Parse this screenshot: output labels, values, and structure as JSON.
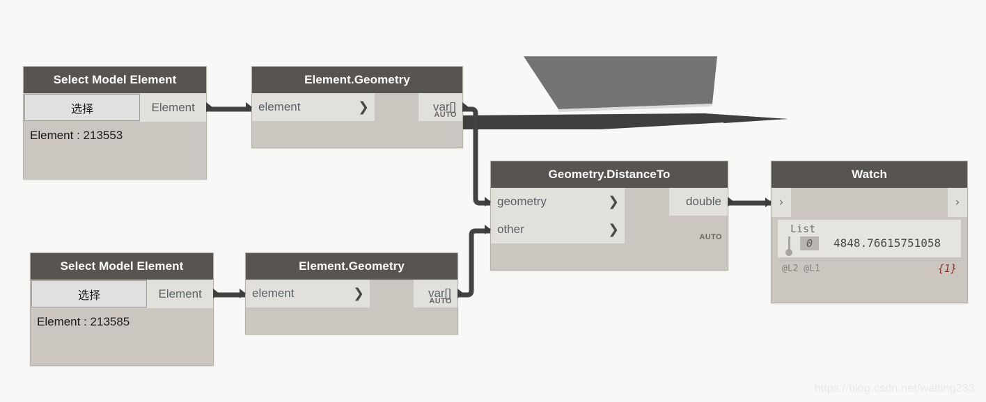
{
  "canvas": {
    "background": "#f8f8f7",
    "watermark": "https://blog.csdn.net/waiting233"
  },
  "theme": {
    "header_bg": "#585551",
    "header_text": "#ffffff",
    "node_body": "#cbc7c0",
    "port_bg": "#e2e0da",
    "port_text": "#5b6168",
    "wire": "#454341",
    "count_red": "#8d3030"
  },
  "nodes": [
    {
      "id": "select-model-element-1",
      "title": "Select Model Element",
      "button_label": "选择",
      "out_port": "Element",
      "value_label": "Element : 213553"
    },
    {
      "id": "element-geometry-1",
      "title": "Element.Geometry",
      "in_port": "element",
      "out_port": "var[]",
      "lacing": "AUTO",
      "chevron": "❯"
    },
    {
      "id": "geometry-distanceto",
      "title": "Geometry.DistanceTo",
      "in_port_1": "geometry",
      "in_port_2": "other",
      "out_port": "double",
      "lacing": "AUTO",
      "chevron": "❯"
    },
    {
      "id": "watch",
      "title": "Watch",
      "left_chevron": "›",
      "right_chevron": "›",
      "list_label": "List",
      "index": "0",
      "value": "4848.76615751058",
      "lacing": "@L2 @L1",
      "count": "{1}"
    },
    {
      "id": "select-model-element-2",
      "title": "Select Model Element",
      "button_label": "选择",
      "out_port": "Element",
      "value_label": "Element : 213585"
    },
    {
      "id": "element-geometry-2",
      "title": "Element.Geometry",
      "in_port": "element",
      "out_port": "var[]",
      "lacing": "AUTO",
      "chevron": "❯"
    }
  ],
  "geometry_preview": {
    "slab_fill": "#737373",
    "sliver_fill": "#3f3f3e",
    "description": "floor slab parallelogram and thin dark beam sliver"
  }
}
